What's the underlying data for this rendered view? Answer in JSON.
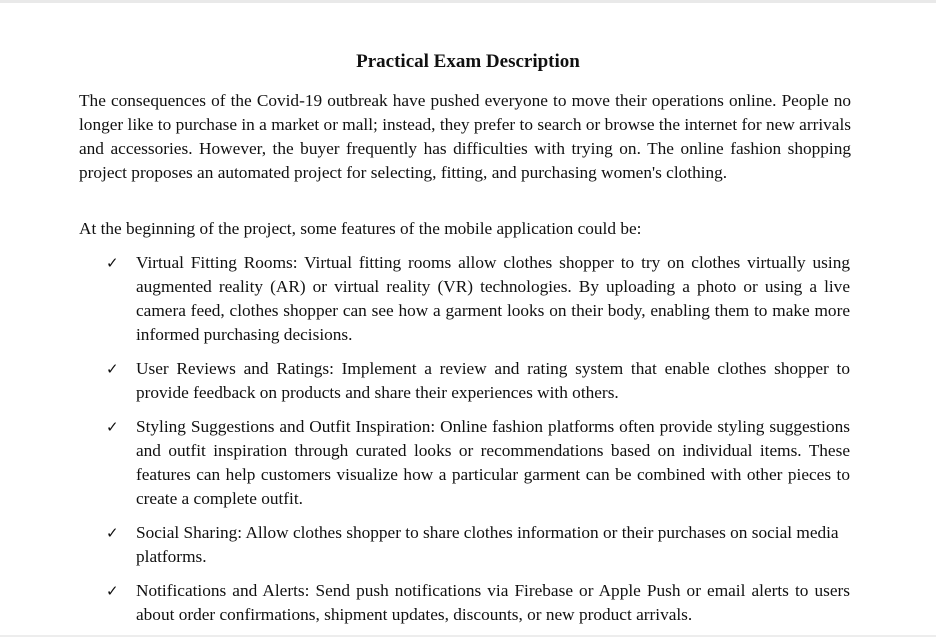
{
  "document": {
    "title": "Practical Exam Description",
    "intro": "The consequences of the Covid-19 outbreak have pushed everyone to move their operations online. People no longer like to purchase in a market or mall; instead, they prefer to search or browse the internet for new arrivals and accessories. However, the buyer frequently has difficulties with trying on. The online fashion shopping project proposes an automated project for selecting, fitting, and purchasing women's clothing.",
    "lead": "At the beginning of the project, some features of the mobile application could be:",
    "bullet_glyph": "✓",
    "features": [
      "Virtual Fitting Rooms: Virtual fitting rooms allow clothes shopper to try on clothes virtually using augmented reality (AR) or virtual reality (VR) technologies. By uploading a photo or using a live camera feed, clothes shopper can see how a garment looks on their body, enabling them to make more informed purchasing decisions.",
      "User Reviews and Ratings: Implement a review and rating system that enable clothes shopper to provide feedback on products and share their experiences with others.",
      "Styling Suggestions and Outfit Inspiration: Online fashion platforms often provide styling suggestions and outfit inspiration through curated looks or recommendations based on individual items. These features can help customers visualize how a particular garment can be combined with other pieces to create a complete outfit.",
      "Social Sharing: Allow clothes shopper to share clothes information or their purchases on social media platforms.",
      "Notifications and Alerts: Send push notifications via Firebase or Apple Push or email alerts to users about order confirmations, shipment updates, discounts, or new product arrivals."
    ]
  }
}
